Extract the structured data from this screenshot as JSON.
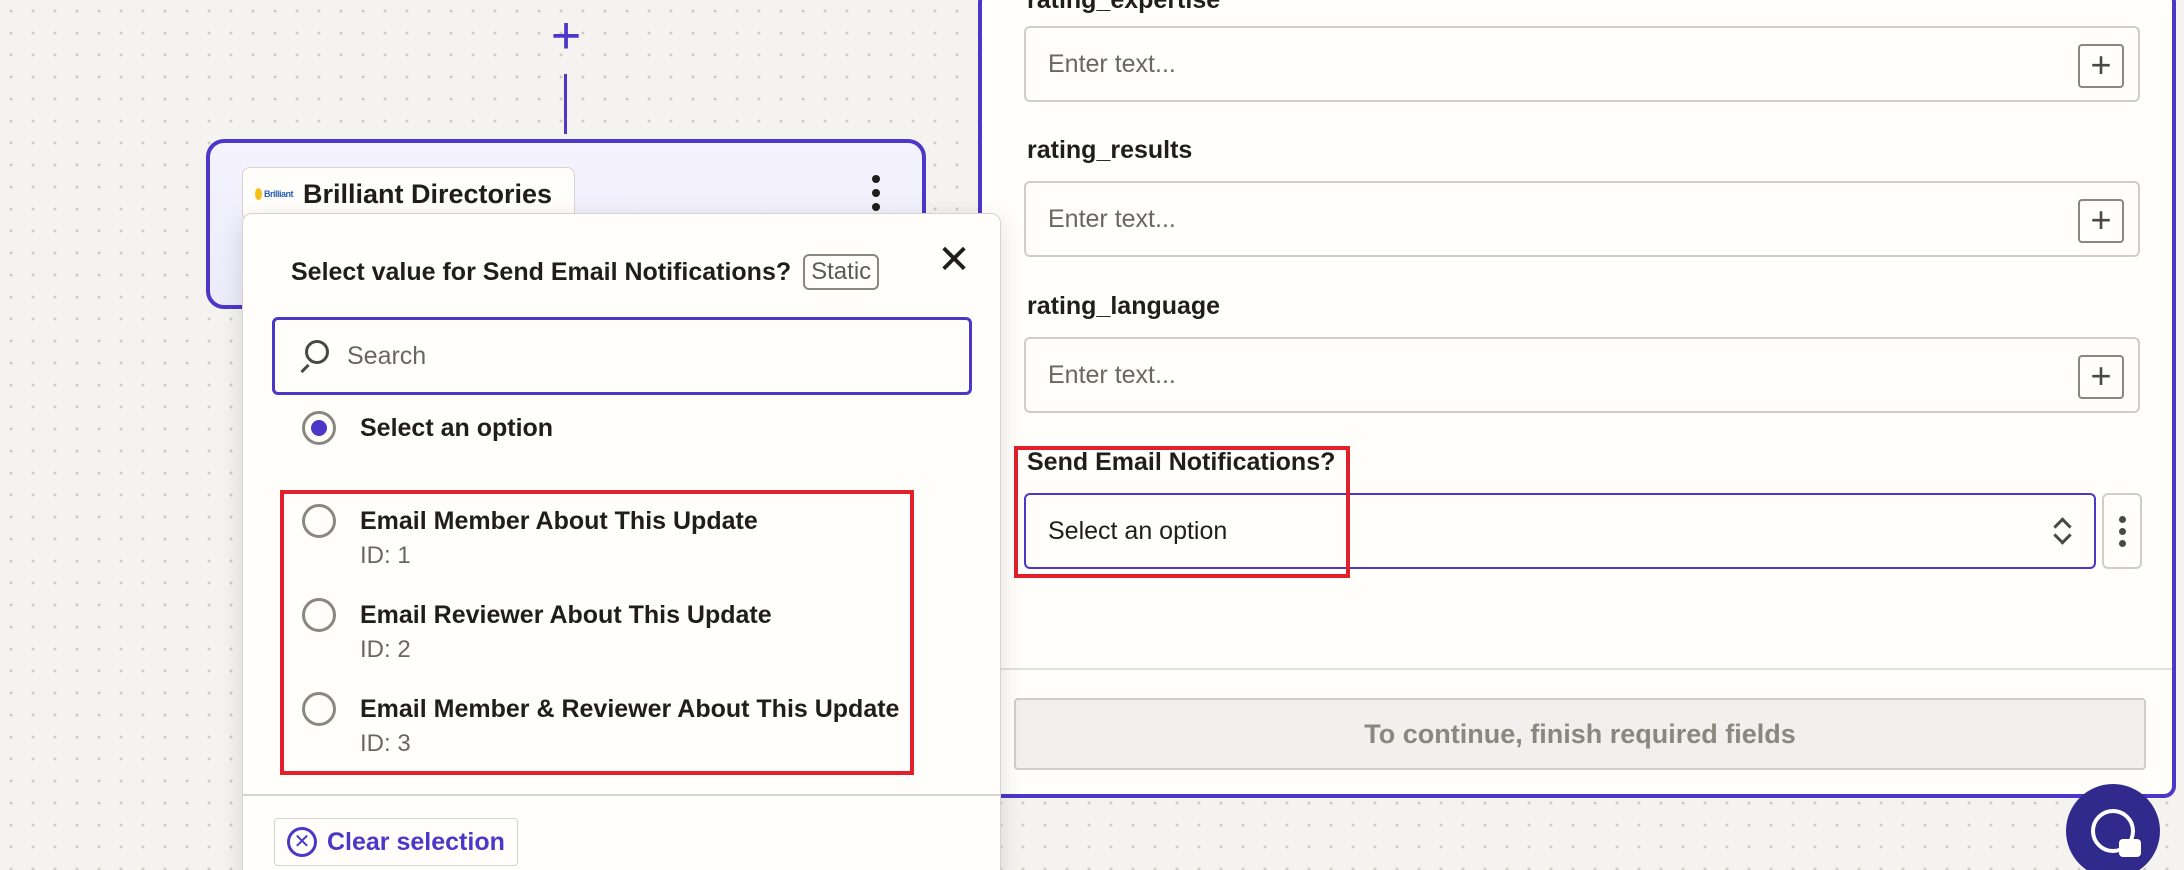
{
  "canvas": {
    "add_step_symbol": "+"
  },
  "step_card": {
    "app_name": "Brilliant Directories",
    "logo_text": "Brilliant"
  },
  "popover": {
    "title": "Select value for Send Email Notifications?",
    "badge": "Static",
    "close_symbol": "✕",
    "search_placeholder": "Search",
    "default_option": "Select an option",
    "options": [
      {
        "label": "Email Member About This Update",
        "id": "ID: 1"
      },
      {
        "label": "Email Reviewer About This Update",
        "id": "ID: 2"
      },
      {
        "label": "Email Member & Reviewer About This Update",
        "id": "ID: 3"
      }
    ],
    "clear_label": "Clear selection",
    "clear_symbol": "✕"
  },
  "form": {
    "partial_label": "rating_expertise",
    "fields": [
      {
        "label": "rating_results",
        "placeholder": "Enter text..."
      },
      {
        "label": "rating_language",
        "placeholder": "Enter text..."
      }
    ],
    "first_placeholder": "Enter text...",
    "plus_symbol": "+",
    "send_email_label": "Send Email Notifications?",
    "send_email_value": "Select an option",
    "continue_label": "To continue, finish required fields"
  },
  "colors": {
    "accent": "#4b37c8",
    "highlight": "#e0202a",
    "fab": "#2f2a8c"
  }
}
